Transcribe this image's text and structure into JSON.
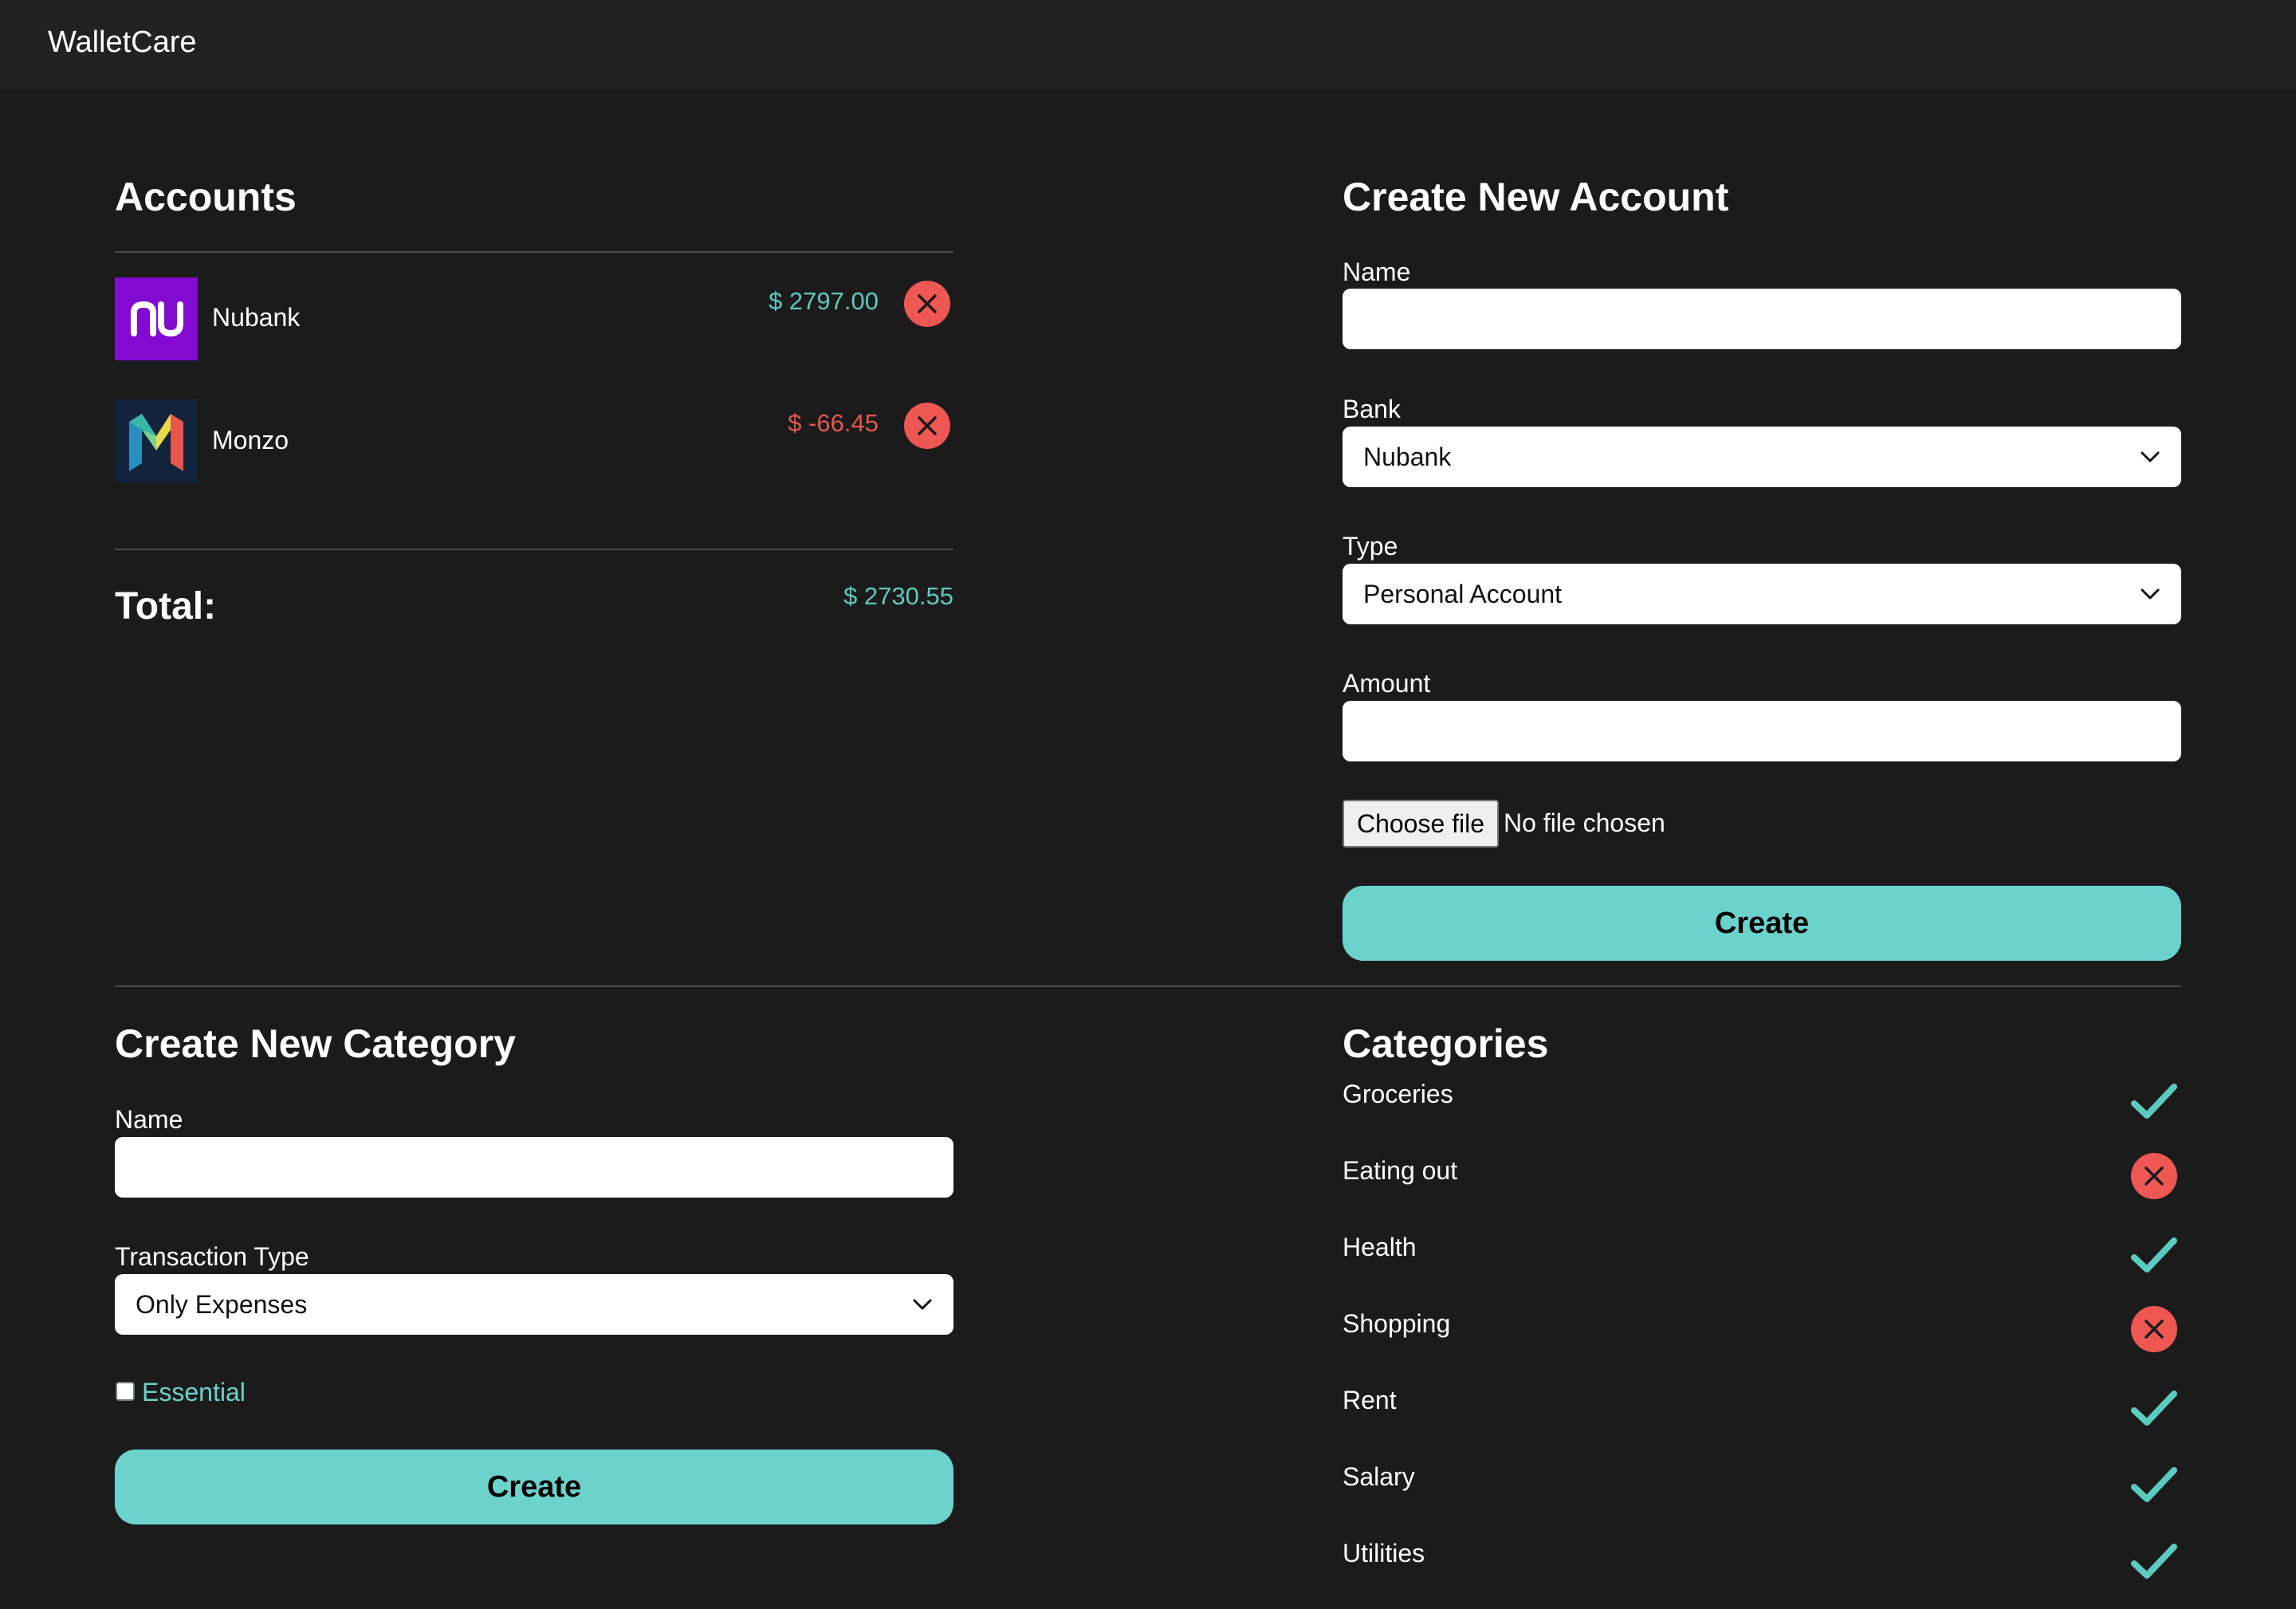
{
  "app": {
    "title": "WalletCare"
  },
  "accounts": {
    "heading": "Accounts",
    "items": [
      {
        "name": "Nubank",
        "amount": "$ 2797.00",
        "status": "positive",
        "logo_icon": "nubank-logo",
        "logo_text": "nu"
      },
      {
        "name": "Monzo",
        "amount": "$ -66.45",
        "status": "negative",
        "logo_icon": "monzo-logo"
      }
    ],
    "total_label": "Total:",
    "total_amount": "$ 2730.55"
  },
  "create_account": {
    "heading": "Create New Account",
    "name_label": "Name",
    "name_value": "",
    "bank_label": "Bank",
    "bank_value": "Nubank",
    "type_label": "Type",
    "type_value": "Personal Account",
    "amount_label": "Amount",
    "amount_value": "",
    "file_button": "Choose file",
    "file_status": "No file chosen",
    "submit": "Create"
  },
  "create_category": {
    "heading": "Create New Category",
    "name_label": "Name",
    "name_value": "",
    "transaction_type_label": "Transaction Type",
    "transaction_type_value": "Only Expenses",
    "essential_label": "Essential",
    "essential_checked": false,
    "submit": "Create"
  },
  "categories": {
    "heading": "Categories",
    "items": [
      {
        "name": "Groceries",
        "essential": true,
        "icon": "check-icon"
      },
      {
        "name": "Eating out",
        "essential": false,
        "icon": "x-circle-icon"
      },
      {
        "name": "Health",
        "essential": true,
        "icon": "check-icon"
      },
      {
        "name": "Shopping",
        "essential": false,
        "icon": "x-circle-icon"
      },
      {
        "name": "Rent",
        "essential": true,
        "icon": "check-icon"
      },
      {
        "name": "Salary",
        "essential": true,
        "icon": "check-icon"
      },
      {
        "name": "Utilities",
        "essential": true,
        "icon": "check-icon"
      }
    ]
  },
  "colors": {
    "background": "#1c1b1c",
    "topbar": "#222222",
    "accent": "#6bd3cc",
    "positive": "#5ccbbf",
    "negative": "#e0574f",
    "delete": "#ef5753",
    "nubank_brand": "#820ad1",
    "monzo_bg": "#14233c"
  }
}
